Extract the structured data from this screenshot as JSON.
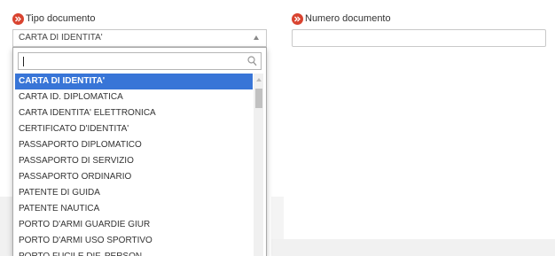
{
  "fields": {
    "tipo_documento": {
      "label": "Tipo documento",
      "selected_value": "CARTA DI IDENTITA'"
    },
    "numero_documento": {
      "label": "Numero documento",
      "value": ""
    }
  },
  "dropdown": {
    "search_value": "",
    "options": [
      "CARTA DI IDENTITA'",
      "CARTA ID. DIPLOMATICA",
      "CARTA IDENTITA' ELETTRONICA",
      "CERTIFICATO D'IDENTITA'",
      "PASSAPORTO DIPLOMATICO",
      "PASSAPORTO DI SERVIZIO",
      "PASSAPORTO ORDINARIO",
      "PATENTE DI GUIDA",
      "PATENTE NAUTICA",
      "PORTO D'ARMI GUARDIE GIUR",
      "PORTO D'ARMI USO SPORTIVO",
      "PORTO FUCILE DIF. PERSON."
    ],
    "highlighted_index": 0
  },
  "icons": {
    "required": "double-chevron-right-icon",
    "search": "search-icon"
  },
  "colors": {
    "required_icon": "#d9432f",
    "highlight": "#3875d7"
  }
}
